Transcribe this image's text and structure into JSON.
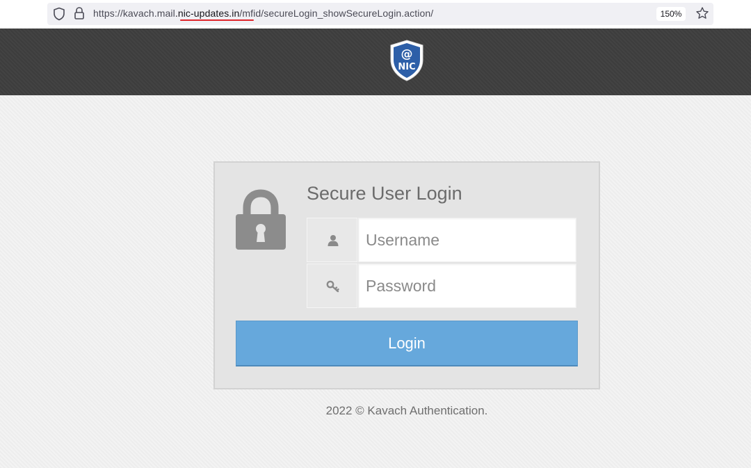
{
  "browser": {
    "url_prefix": "https://kavach.mail",
    "url_domain": ".nic-updates.in",
    "url_suffix": "/mfid/secureLogin_showSecureLogin.action/",
    "zoom_level": "150%",
    "icons": [
      "shield-icon",
      "lock-icon",
      "star-icon"
    ]
  },
  "header": {
    "logo_text": "NIC",
    "logo_symbol": "@",
    "colors": {
      "band": "#404040",
      "logo_blue": "#2d5fa8"
    }
  },
  "login": {
    "title": "Secure User Login",
    "username_placeholder": "Username",
    "username_value": "",
    "password_placeholder": "Password",
    "password_value": "",
    "button_label": "Login",
    "icons": [
      "padlock-icon",
      "user-icon",
      "key-icon"
    ],
    "colors": {
      "button": "#66a8dc",
      "panel": "#e4e4e4"
    }
  },
  "footer": {
    "text": "2022 © Kavach Authentication."
  }
}
